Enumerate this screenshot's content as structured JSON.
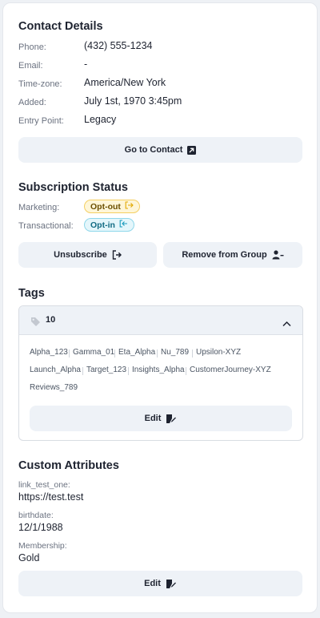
{
  "contact": {
    "title": "Contact Details",
    "rows": [
      {
        "label": "Phone:",
        "value": "(432) 555-1234"
      },
      {
        "label": "Email:",
        "value": "-"
      },
      {
        "label": "Time-zone:",
        "value": "America/New York"
      },
      {
        "label": "Added:",
        "value": "July 1st, 1970 3:45pm"
      },
      {
        "label": "Entry Point:",
        "value": "Legacy"
      }
    ],
    "go_button": "Go to Contact"
  },
  "subscription": {
    "title": "Subscription Status",
    "marketing_label": "Marketing:",
    "marketing_badge": "Opt-out",
    "transactional_label": "Transactional:",
    "transactional_badge": "Opt-in",
    "unsubscribe_button": "Unsubscribe",
    "remove_button": "Remove from Group"
  },
  "tags": {
    "title": "Tags",
    "count": "10",
    "items": [
      "Alpha_123",
      "Gamma_01",
      "Eta_Alpha",
      "Nu_789",
      "Upsilon-XYZ",
      "Launch_Alpha",
      "Target_123",
      "Insights_Alpha",
      "CustomerJourney-XYZ",
      "Reviews_789"
    ],
    "edit_button": "Edit"
  },
  "attributes": {
    "title": "Custom Attributes",
    "items": [
      {
        "label": "link_test_one:",
        "value": "https://test.test"
      },
      {
        "label": "birthdate:",
        "value": "12/1/1988"
      },
      {
        "label": "Membership:",
        "value": "Gold"
      }
    ],
    "edit_button": "Edit"
  },
  "colors": {
    "opt_out_bg": "#fef6d8",
    "opt_out_border": "#f4cf62",
    "opt_in_bg": "#e4f6fb",
    "opt_in_border": "#8fd7ea",
    "button_bg": "#eef2f7"
  },
  "icons": {
    "go_to_contact": "external-link-icon",
    "unsubscribe": "sign-out-icon",
    "remove_from_group": "user-minus-icon",
    "tags": "tag-icon",
    "collapse": "chevron-up-icon",
    "edit": "edit-pen-icon",
    "opt_out": "sign-out-icon",
    "opt_in": "sign-in-icon"
  }
}
